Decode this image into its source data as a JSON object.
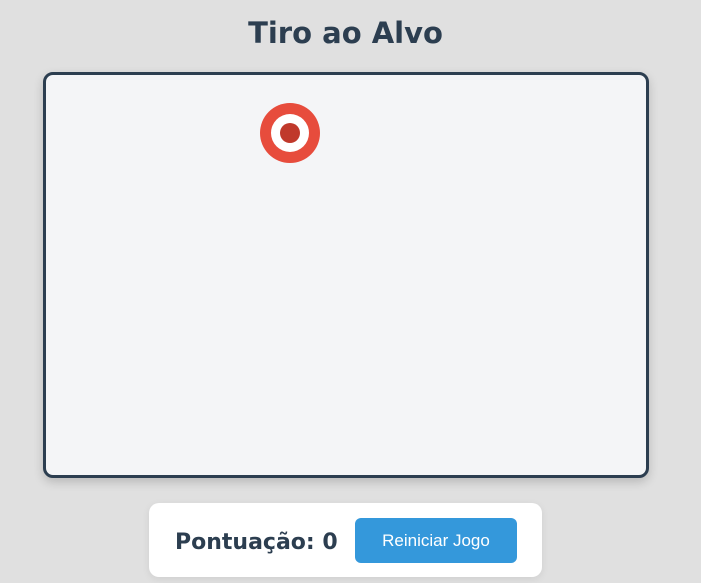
{
  "title": "Tiro ao Alvo",
  "score": {
    "label": "Pontuação:",
    "value": "0"
  },
  "restart_button": {
    "label": "Reiniciar Jogo"
  },
  "colors": {
    "background": "#e0e0e0",
    "game_area_background": "#f4f5f7",
    "game_area_border": "#2c3e50",
    "target_outer": "#e74c3c",
    "target_middle": "#ffffff",
    "target_center": "#c0392b",
    "title_text": "#2c3e50",
    "button_background": "#3498db",
    "button_text": "#ffffff"
  },
  "icons": {
    "target": "bullseye-target-icon"
  }
}
